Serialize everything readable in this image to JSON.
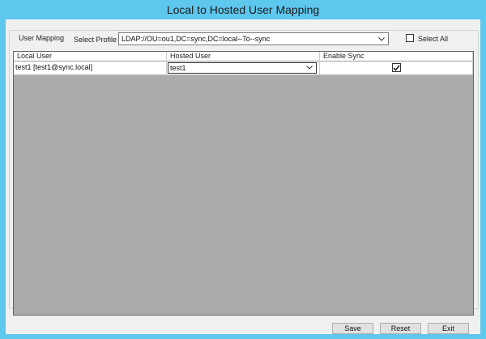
{
  "window": {
    "title": "Local to Hosted User Mapping"
  },
  "group": {
    "legend": "User Mapping"
  },
  "profile": {
    "label": "Select Profile",
    "value": "LDAP://OU=ou1,DC=sync,DC=local--To--sync"
  },
  "select_all": {
    "label": "Select All",
    "checked": false
  },
  "grid": {
    "columns": [
      "Local User",
      "Hosted User",
      "Enable Sync"
    ],
    "rows": [
      {
        "local_user": "test1 [test1@sync.local]",
        "hosted_user": "test1",
        "enable_sync": true
      }
    ]
  },
  "buttons": {
    "save": "Save",
    "reset": "Reset",
    "exit": "Exit"
  },
  "icons": {
    "combo_arrow": "chevron-down-icon",
    "check": "check-icon"
  }
}
